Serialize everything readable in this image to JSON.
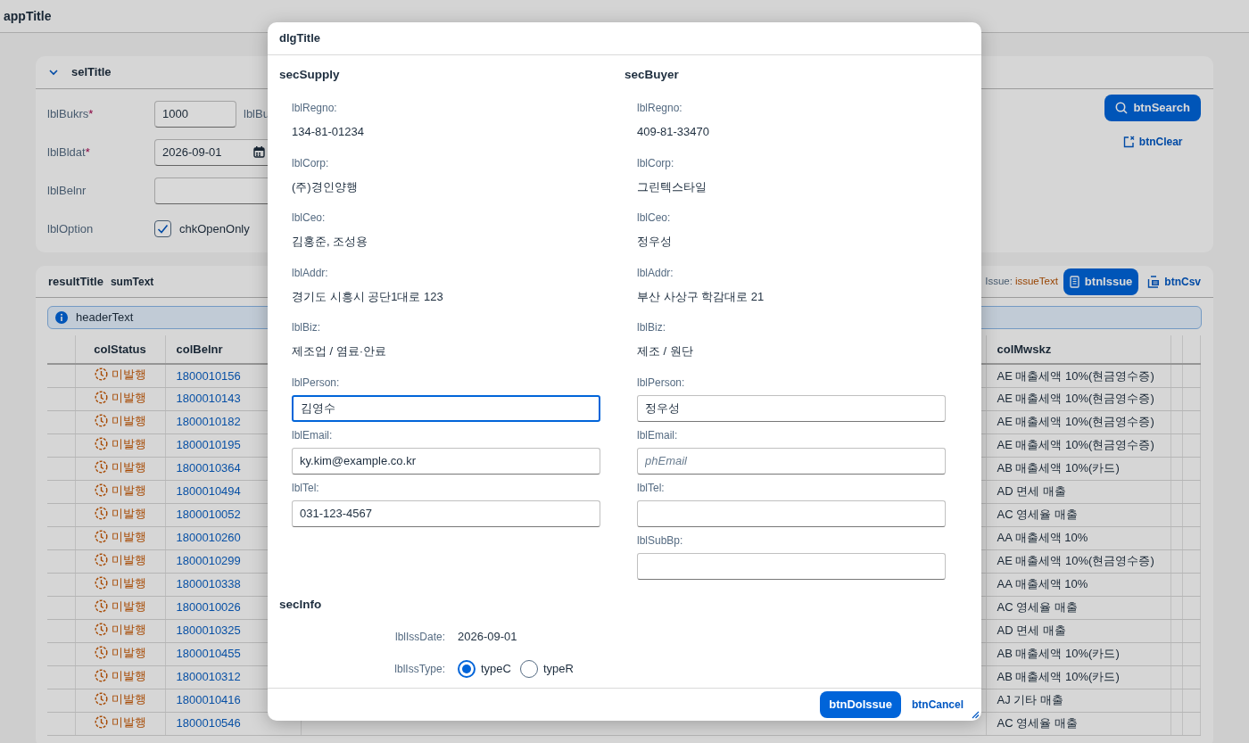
{
  "app": {
    "title": "appTitle"
  },
  "selection": {
    "title": "selTitle",
    "expanded": true,
    "fields": [
      {
        "kind": "input",
        "label": "lblBukrs",
        "required_mark": "*",
        "value": "1000",
        "trailing_label": "lblBu"
      },
      {
        "kind": "date",
        "label": "lblBldat",
        "required_mark": "*",
        "value": "2026-09-01"
      },
      {
        "kind": "input",
        "label": "lblBelnr"
      },
      {
        "kind": "checkbox",
        "label": "lblOption",
        "text": "chkOpenOnly",
        "checked": true
      }
    ],
    "buttons": [
      {
        "kind": "primary",
        "label": "btnSearch"
      },
      {
        "kind": "link",
        "label": "btnClear"
      }
    ]
  },
  "result": {
    "title": "resultTitle",
    "summary": "sumText",
    "issue_label": "Issue:",
    "issue_text": "issueText",
    "buttons": [
      {
        "kind": "primary",
        "label": "btnIssue"
      },
      {
        "kind": "link",
        "label": "btnCsv"
      }
    ],
    "info": "headerText",
    "columns": [
      "colStatus",
      "colBelnr",
      "colMwskz"
    ],
    "rows": [
      {
        "status": "미발행",
        "belnr": "1800010156",
        "mwskz": "AE 매출세액 10%(현금영수증)"
      },
      {
        "status": "미발행",
        "belnr": "1800010143",
        "mwskz": "AE 매출세액 10%(현금영수증)"
      },
      {
        "status": "미발행",
        "belnr": "1800010182",
        "mwskz": "AE 매출세액 10%(현금영수증)"
      },
      {
        "status": "미발행",
        "belnr": "1800010195",
        "mwskz": "AE 매출세액 10%(현금영수증)"
      },
      {
        "status": "미발행",
        "belnr": "1800010364",
        "mwskz": "AB 매출세액 10%(카드)"
      },
      {
        "status": "미발행",
        "belnr": "1800010494",
        "mwskz": "AD 면세 매출"
      },
      {
        "status": "미발행",
        "belnr": "1800010052",
        "mwskz": "AC 영세율 매출"
      },
      {
        "status": "미발행",
        "belnr": "1800010260",
        "mwskz": "AA 매출세액 10%"
      },
      {
        "status": "미발행",
        "belnr": "1800010299",
        "mwskz": "AE 매출세액 10%(현금영수증)"
      },
      {
        "status": "미발행",
        "belnr": "1800010338",
        "mwskz": "AA 매출세액 10%"
      },
      {
        "status": "미발행",
        "belnr": "1800010026",
        "mwskz": "AC 영세율 매출"
      },
      {
        "status": "미발행",
        "belnr": "1800010325",
        "mwskz": "AD 면세 매출"
      },
      {
        "status": "미발행",
        "belnr": "1800010455",
        "mwskz": "AB 매출세액 10%(카드)"
      },
      {
        "status": "미발행",
        "belnr": "1800010312",
        "mwskz": "AB 매출세액 10%(카드)"
      },
      {
        "status": "미발행",
        "belnr": "1800010416",
        "mwskz": "AJ 기타 매출"
      },
      {
        "status": "미발행",
        "belnr": "1800010546",
        "mwskz": "AC 영세율 매출"
      }
    ]
  },
  "dialog": {
    "title": "dlgTitle",
    "sections": [
      {
        "title": "secSupply",
        "fields": [
          {
            "kind": "text",
            "label": "lblRegno:",
            "value": "134-81-01234"
          },
          {
            "kind": "text",
            "label": "lblCorp:",
            "value": "(주)경인양행"
          },
          {
            "kind": "text",
            "label": "lblCeo:",
            "value": "김홍준, 조성용"
          },
          {
            "kind": "text",
            "label": "lblAddr:",
            "value": "경기도 시흥시 공단1대로 123"
          },
          {
            "kind": "text",
            "label": "lblBiz:",
            "value": "제조업 / 염료·안료"
          },
          {
            "kind": "input",
            "label": "lblPerson:",
            "value": "김영수",
            "focused": true
          },
          {
            "kind": "input",
            "label": "lblEmail:",
            "value": "ky.kim@example.co.kr"
          },
          {
            "kind": "input",
            "label": "lblTel:",
            "value": "031-123-4567"
          }
        ]
      },
      {
        "title": "secBuyer",
        "fields": [
          {
            "kind": "text",
            "label": "lblRegno:",
            "value": "409-81-33470"
          },
          {
            "kind": "text",
            "label": "lblCorp:",
            "value": "그린텍스타일"
          },
          {
            "kind": "text",
            "label": "lblCeo:",
            "value": "정우성"
          },
          {
            "kind": "text",
            "label": "lblAddr:",
            "value": "부산 사상구 학감대로 21"
          },
          {
            "kind": "text",
            "label": "lblBiz:",
            "value": "제조 / 원단"
          },
          {
            "kind": "input",
            "label": "lblPerson:",
            "value": "정우성"
          },
          {
            "kind": "input",
            "label": "lblEmail:",
            "placeholder": "phEmail"
          },
          {
            "kind": "input",
            "label": "lblTel:"
          },
          {
            "kind": "input",
            "label": "lblSubBp:"
          }
        ]
      }
    ],
    "info": {
      "title": "secInfo",
      "issue_date_label": "lblIssDate:",
      "issue_date": "2026-09-01",
      "issue_type_label": "lblIssType:",
      "types": [
        {
          "label": "typeC",
          "selected": true
        },
        {
          "label": "typeR",
          "selected": false
        }
      ]
    },
    "buttons": [
      {
        "kind": "primary",
        "label": "btnDoIssue"
      },
      {
        "kind": "link",
        "label": "btnCancel"
      }
    ]
  }
}
